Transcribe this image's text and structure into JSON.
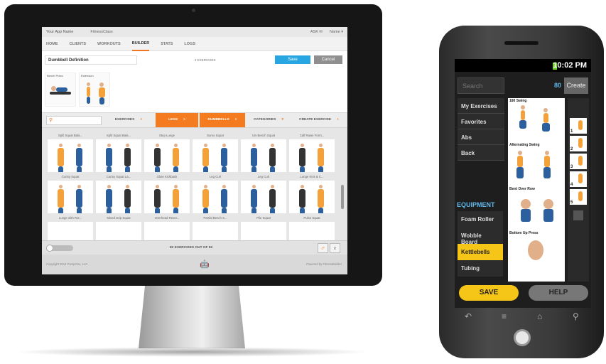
{
  "desktop": {
    "top_bar": {
      "app_name": "Your App Name",
      "brand": "FitnessClass",
      "ask": "ASK",
      "user": "Name ▾"
    },
    "nav_tabs": [
      "HOME",
      "CLIENTS",
      "WORKOUTS",
      "BUILDER",
      "STATS",
      "LOGS"
    ],
    "active_tab": "BUILDER",
    "builder": {
      "routine_name": "Dumbbell Definition",
      "exercise_count": "2 EXERCISES",
      "save_label": "Save",
      "cancel_label": "Cancel",
      "selected": [
        "Bench Press",
        "Extension"
      ]
    },
    "filters": {
      "exercises": "EXERCISES",
      "legs": "LEGS",
      "dumbbells": "DUMBBELLS",
      "categories": "CATEGORIES",
      "create": "CREATE EXERCISE",
      "remove_glyph": "×",
      "dropdown_glyph": "▾",
      "add_glyph": "+"
    },
    "grid_labels": [
      "Split Squat Bala...",
      "Split Squat Bala...",
      "Step Lunge",
      "Sumo Squat",
      "Uni Bench Squat",
      "Calf Raise Form...",
      "Curtsy Squat",
      "Curtsy Squat La...",
      "Glute Kickback",
      "Leg Curl",
      "Leg Curl",
      "Lunge Kick & C...",
      "Lunge with Rot...",
      "Mixed Grip Squat",
      "Overhead Rever...",
      "Partial Bench S...",
      "Plie Squat",
      "Pulse Squat"
    ],
    "results": "82 EXERCISES OUT OF 82",
    "male_symbol": "♂",
    "female_symbol": "♀",
    "apple_icon": "",
    "android_icon": "🤖",
    "copyright": "Copyright 2014 PumpOne, LLC",
    "powered": "Powered by FitnessBuilder",
    "accent_color": "#f47b20"
  },
  "phone": {
    "time": "10:02 PM",
    "search_placeholder": "Search",
    "count": "80",
    "create_label": "Create",
    "categories": [
      "My Exercises",
      "Favorites",
      "Abs",
      "Back"
    ],
    "equipment_title": "EQUIPMENT",
    "equipment": [
      "Foam Roller",
      "Wobble Board",
      "Kettlebells",
      "Tubing"
    ],
    "active_equipment": "Kettlebells",
    "exercises": [
      "180 Swing",
      "Alternating Swing",
      "Bent Over Row",
      "Bottom Up Press"
    ],
    "routine_slots": [
      "1",
      "2",
      "3",
      "4",
      "5"
    ],
    "save_label": "SAVE",
    "help_label": "HELP",
    "male_symbol": "♂",
    "female_symbol": "♀",
    "softkeys": [
      "↶",
      "≡",
      "⌂",
      "⚲"
    ],
    "accent_color": "#f5c518"
  }
}
